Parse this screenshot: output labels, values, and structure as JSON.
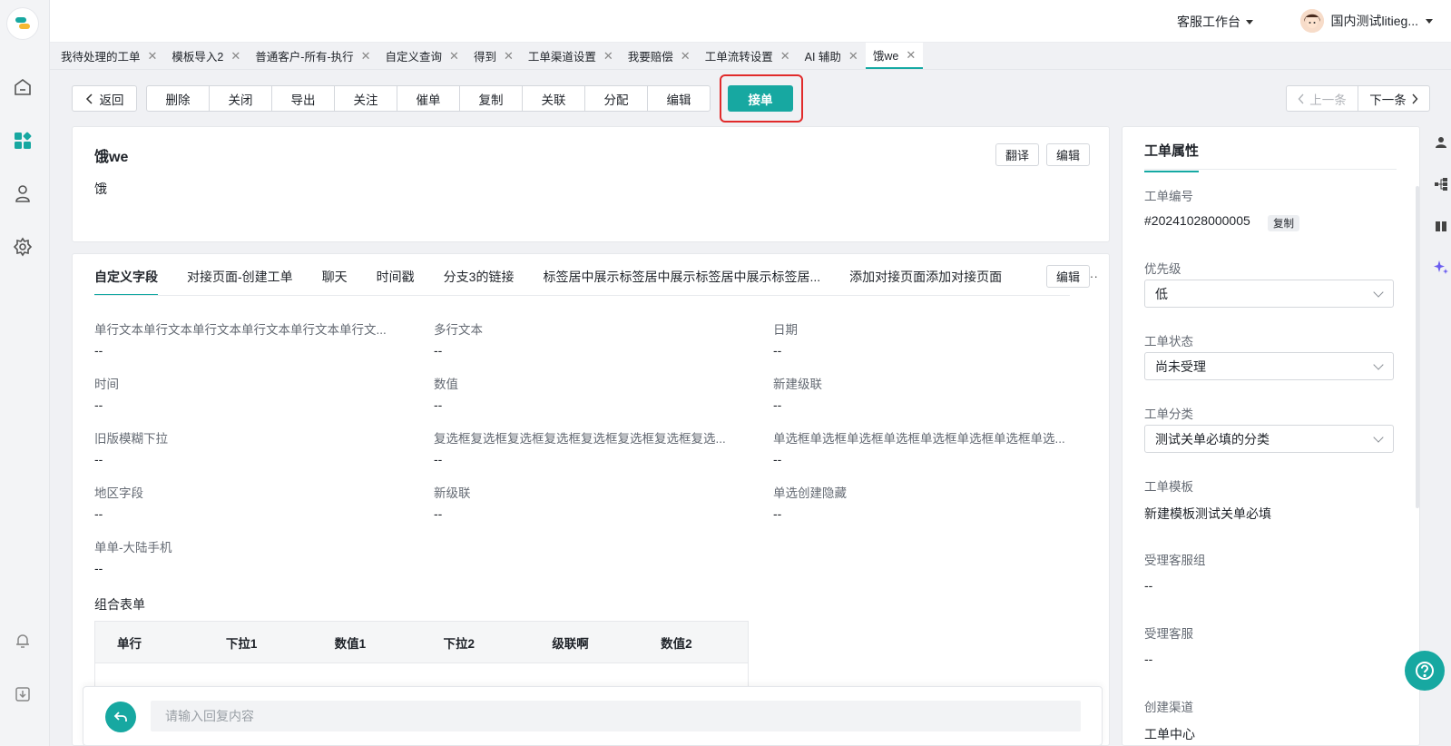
{
  "header": {
    "workspace": "客服工作台",
    "user_name": "国内测试litieg..."
  },
  "tabs": [
    {
      "label": "我待处理的工单"
    },
    {
      "label": "模板导入2"
    },
    {
      "label": "普通客户-所有-执行"
    },
    {
      "label": "自定义查询"
    },
    {
      "label": "得到"
    },
    {
      "label": "工单渠道设置"
    },
    {
      "label": "我要赔偿"
    },
    {
      "label": "工单流转设置"
    },
    {
      "label": "AI 辅助"
    },
    {
      "label": "饿we"
    }
  ],
  "toolbar": {
    "back": "返回",
    "actions": [
      "删除",
      "关闭",
      "导出",
      "关注",
      "催单",
      "复制",
      "关联",
      "分配",
      "编辑"
    ],
    "accept": "接单",
    "prev": "上一条",
    "next": "下一条"
  },
  "ticket": {
    "title": "饿we",
    "description": "饿",
    "translate": "翻译",
    "edit": "编辑"
  },
  "field_tabs": {
    "items": [
      "自定义字段",
      "对接页面-创建工单",
      "聊天",
      "时间戳",
      "分支3的链接",
      "标签居中展示标签居中展示标签居中展示标签居...",
      "添加对接页面添加对接页面"
    ],
    "more": "···",
    "edit": "编辑"
  },
  "fields": [
    {
      "label": "单行文本单行文本单行文本单行文本单行文本单行文...",
      "value": "--"
    },
    {
      "label": "多行文本",
      "value": "--"
    },
    {
      "label": "日期",
      "value": "--"
    },
    {
      "label": "时间",
      "value": "--"
    },
    {
      "label": "数值",
      "value": "--"
    },
    {
      "label": "新建级联",
      "value": "--"
    },
    {
      "label": "旧版模糊下拉",
      "value": "--"
    },
    {
      "label": "复选框复选框复选框复选框复选框复选框复选框复选...",
      "value": "--"
    },
    {
      "label": "单选框单选框单选框单选框单选框单选框单选框单选...",
      "value": "--"
    },
    {
      "label": "地区字段",
      "value": "--"
    },
    {
      "label": "新级联",
      "value": "--"
    },
    {
      "label": "单选创建隐藏",
      "value": "--"
    },
    {
      "label": "单单-大陆手机",
      "value": "--"
    }
  ],
  "combo_form": {
    "label": "组合表单",
    "columns": [
      "单行",
      "下拉1",
      "数值1",
      "下拉2",
      "级联啊",
      "数值2"
    ]
  },
  "reply": {
    "placeholder": "请输入回复内容"
  },
  "properties": {
    "title": "工单属性",
    "ticket_no_label": "工单编号",
    "ticket_no": "#20241028000005",
    "copy": "复制",
    "priority_label": "优先级",
    "priority": "低",
    "status_label": "工单状态",
    "status": "尚未受理",
    "category_label": "工单分类",
    "category": "测试关单必填的分类",
    "template_label": "工单模板",
    "template": "新建模板测试关单必填",
    "group_label": "受理客服组",
    "group": "--",
    "agent_label": "受理客服",
    "agent": "--",
    "channel_label": "创建渠道",
    "channel": "工单中心"
  },
  "colors": {
    "accent": "#17a8a1",
    "highlight_border": "#e12b2b"
  }
}
